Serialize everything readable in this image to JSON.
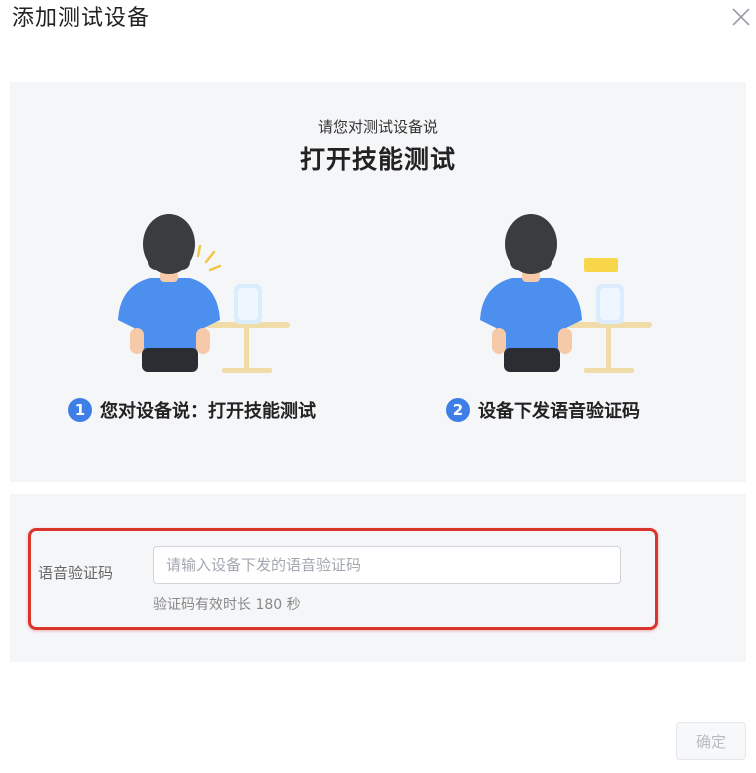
{
  "dialog": {
    "title": "添加测试设备",
    "close_icon": "close-icon"
  },
  "illustration": {
    "subtitle": "请您对测试设备说",
    "title": "打开技能测试",
    "steps": [
      {
        "number": "1",
        "text": "您对设备说：打开技能测试"
      },
      {
        "number": "2",
        "text": "设备下发语音验证码"
      }
    ]
  },
  "form": {
    "label": "语音验证码",
    "placeholder": "请输入设备下发的语音验证码",
    "value": "",
    "hint": "验证码有效时长 180 秒"
  },
  "footer": {
    "confirm_label": "确定"
  },
  "colors": {
    "accent_blue": "#3d7fe6",
    "shirt_blue": "#4d8fef",
    "highlight_red": "#d9352c",
    "bubble_yellow": "#f7d64a",
    "panel_bg": "#f5f6f8"
  }
}
